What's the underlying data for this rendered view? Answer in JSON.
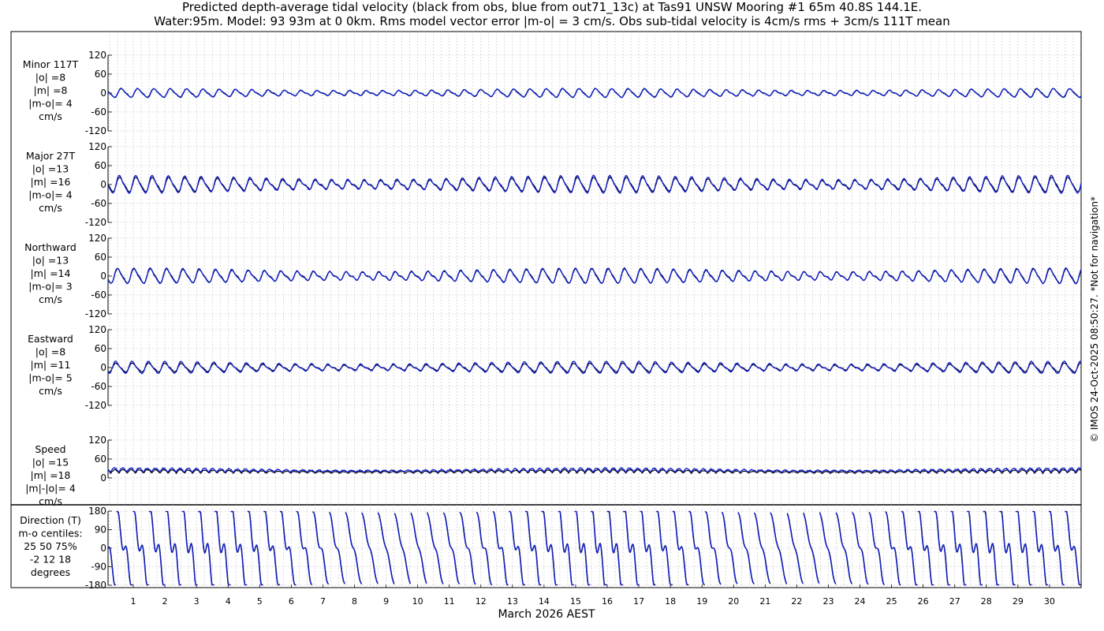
{
  "title": {
    "line1": "Predicted depth-average tidal velocity (black from obs, blue from out71_13c) at Tas91 UNSW Mooring #1 65m 40.8S 144.1E.",
    "line2": "Water:95m. Model: 93 93m at 0 0km. Rms model vector error |m-o| = 3 cm/s. Obs sub-tidal velocity is 4cm/s rms + 3cm/s 111T mean"
  },
  "copyright": "© IMOS 24-Oct-2025 08:50:27. *Not for navigation*",
  "colors": {
    "obs": "#000000",
    "model": "#1020c8",
    "grid": "#b0b0b0"
  },
  "chart_data": [
    {
      "type": "line",
      "id": "minor",
      "label_lines": [
        "Minor 117T",
        "|o| =8",
        "|m| =8",
        "|m-o|= 4",
        "cm/s"
      ],
      "ylim": [
        -120,
        120
      ],
      "yticks": [
        "120",
        "60",
        "0",
        "-60",
        "-120"
      ],
      "series": [
        {
          "role": "obs",
          "amp": 8,
          "bias": 0
        },
        {
          "role": "model",
          "amp": 8,
          "bias": 0
        }
      ]
    },
    {
      "type": "line",
      "id": "major",
      "label_lines": [
        "Major 27T",
        "|o| =13",
        "|m| =16",
        "|m-o|= 4",
        "cm/s"
      ],
      "ylim": [
        -120,
        120
      ],
      "yticks": [
        "120",
        "60",
        "0",
        "-60",
        "-120"
      ],
      "series": [
        {
          "role": "obs",
          "amp": 13,
          "bias": 0
        },
        {
          "role": "model",
          "amp": 16,
          "bias": 0
        }
      ]
    },
    {
      "type": "line",
      "id": "northward",
      "label_lines": [
        "Northward",
        "|o| =13",
        "|m| =14",
        "|m-o|= 3",
        "cm/s"
      ],
      "ylim": [
        -120,
        120
      ],
      "yticks": [
        "120",
        "60",
        "0",
        "-60",
        "-120"
      ],
      "series": [
        {
          "role": "obs",
          "amp": 13,
          "bias": 0
        },
        {
          "role": "model",
          "amp": 14,
          "bias": 0
        }
      ]
    },
    {
      "type": "line",
      "id": "eastward",
      "label_lines": [
        "Eastward",
        "|o| =8",
        "|m| =11",
        "|m-o|= 5",
        "cm/s"
      ],
      "ylim": [
        -120,
        120
      ],
      "yticks": [
        "120",
        "60",
        "0",
        "-60",
        "-120"
      ],
      "series": [
        {
          "role": "obs",
          "amp": 8,
          "bias": 0
        },
        {
          "role": "model",
          "amp": 11,
          "bias": 0
        }
      ]
    },
    {
      "type": "line",
      "id": "speed",
      "label_lines": [
        "Speed",
        "|o| =15",
        "|m| =18",
        "|m|-|o|= 4",
        "cm/s"
      ],
      "ylim": [
        0,
        120
      ],
      "yticks": [
        "120",
        "60",
        "0"
      ],
      "series": [
        {
          "role": "obs",
          "amp": 15,
          "bias": 15
        },
        {
          "role": "model",
          "amp": 18,
          "bias": 18
        }
      ]
    },
    {
      "type": "line",
      "id": "direction",
      "label_lines": [
        "Direction (T)",
        "m-o centiles:",
        "25  50  75%",
        "-2  12  18",
        "degrees"
      ],
      "ylim": [
        -180,
        180
      ],
      "yticks": [
        "180",
        "90",
        "0",
        "-90",
        "-180"
      ],
      "series": [
        {
          "role": "obs"
        },
        {
          "role": "model"
        }
      ]
    }
  ],
  "xaxis": {
    "label": "March 2026 AEST",
    "days": [
      "1",
      "2",
      "3",
      "4",
      "5",
      "6",
      "7",
      "8",
      "9",
      "10",
      "11",
      "12",
      "13",
      "14",
      "15",
      "16",
      "17",
      "18",
      "19",
      "20",
      "21",
      "22",
      "23",
      "24",
      "25",
      "26",
      "27",
      "28",
      "29",
      "30"
    ],
    "xlim_days": [
      0.2,
      31
    ]
  }
}
